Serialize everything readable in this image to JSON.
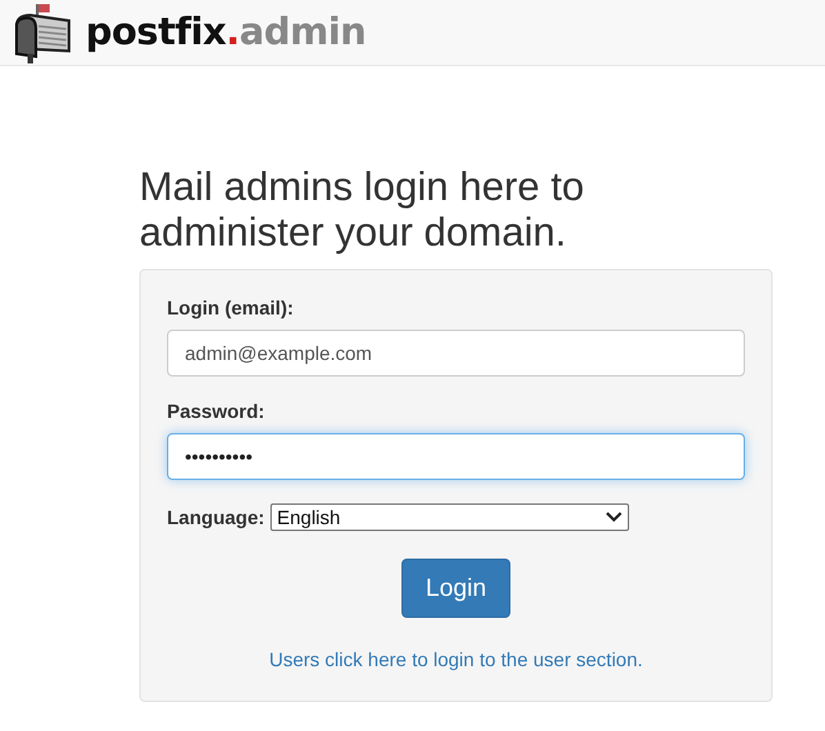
{
  "logo": {
    "name": "postfix",
    "dot": ".",
    "suffix": "admin"
  },
  "heading": "Mail admins login here to administer your domain.",
  "form": {
    "login_label": "Login (email):",
    "login_value": "admin@example.com",
    "password_label": "Password:",
    "password_value": "••••••••••",
    "password_focused": true,
    "language_label": "Language:",
    "language_value": "English",
    "submit": "Login",
    "user_link": "Users click here to login to the user section."
  }
}
